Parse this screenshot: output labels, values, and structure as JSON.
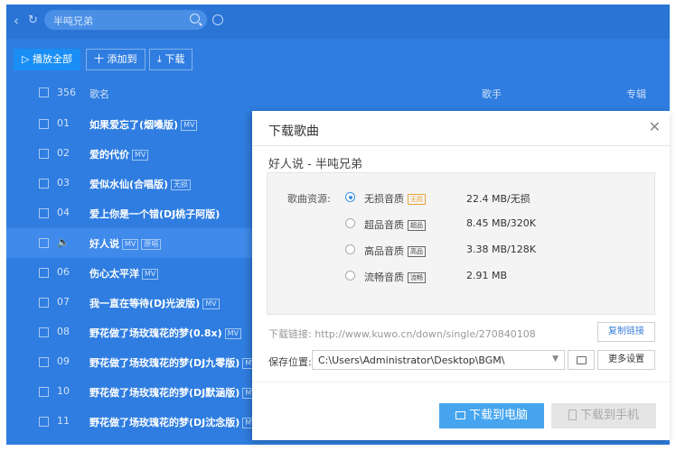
{
  "search": {
    "query": "半吨兄弟"
  },
  "toolbar": {
    "play_all": "▷ 播放全部",
    "add_to": "十 添加到",
    "download": "⤓ 下载"
  },
  "list_header": {
    "count": "356",
    "col_title": "歌名",
    "col_artist": "歌手",
    "col_album": "专辑"
  },
  "songs": [
    {
      "num": "01",
      "title": "如果爱忘了(烟嗓版)",
      "tags": [
        "MV"
      ]
    },
    {
      "num": "02",
      "title": "爱的代价",
      "tags": [
        "MV"
      ]
    },
    {
      "num": "03",
      "title": "爱似水仙(合唱版)",
      "tags": [
        "无损"
      ]
    },
    {
      "num": "04",
      "title": "爱上你是一个错(DJ桃子阿版)",
      "tags": []
    },
    {
      "num": "",
      "title": "好人说",
      "tags": [
        "MV",
        "原唱"
      ],
      "playing": true
    },
    {
      "num": "06",
      "title": "伤心太平洋",
      "tags": [
        "MV"
      ]
    },
    {
      "num": "07",
      "title": "我一直在等待(DJ光波版)",
      "tags": [
        "MV"
      ]
    },
    {
      "num": "08",
      "title": "野花做了场玫瑰花的梦(0.8x)",
      "tags": [
        "MV"
      ]
    },
    {
      "num": "09",
      "title": "野花做了场玫瑰花的梦(DJ九零版)",
      "tags": [
        "MV"
      ]
    },
    {
      "num": "10",
      "title": "野花做了场玫瑰花的梦(DJ默涵版)",
      "tags": [
        "MV"
      ]
    },
    {
      "num": "11",
      "title": "野花做了场玫瑰花的梦(DJ沈念版)",
      "tags": [
        "MV"
      ]
    }
  ],
  "dialog": {
    "title": "下载歌曲",
    "song": "好人说 - 半吨兄弟",
    "source_label": "歌曲资源:",
    "options": [
      {
        "name": "无损音质",
        "tag": "无损",
        "size": "22.4 MB/无损",
        "selected": true
      },
      {
        "name": "超品音质",
        "tag": "超品",
        "size": "8.45 MB/320K",
        "selected": false
      },
      {
        "name": "高品音质",
        "tag": "高品",
        "size": "3.38 MB/128K",
        "selected": false
      },
      {
        "name": "流畅音质",
        "tag": "流畅",
        "size": "2.91 MB",
        "selected": false
      }
    ],
    "link_label": "下载链接:",
    "link_url": "http://www.kuwo.cn/down/single/270840108",
    "copy_link": "复制链接",
    "save_label": "保存位置:",
    "save_path": "C:\\Users\\Administrator\\Desktop\\BGM\\",
    "more_settings": "更多设置",
    "download_pc": "下载到电脑",
    "download_mobile": "下载到手机"
  },
  "colors": {
    "accent": "#2f7de0",
    "primary_button": "#46a5ee"
  }
}
